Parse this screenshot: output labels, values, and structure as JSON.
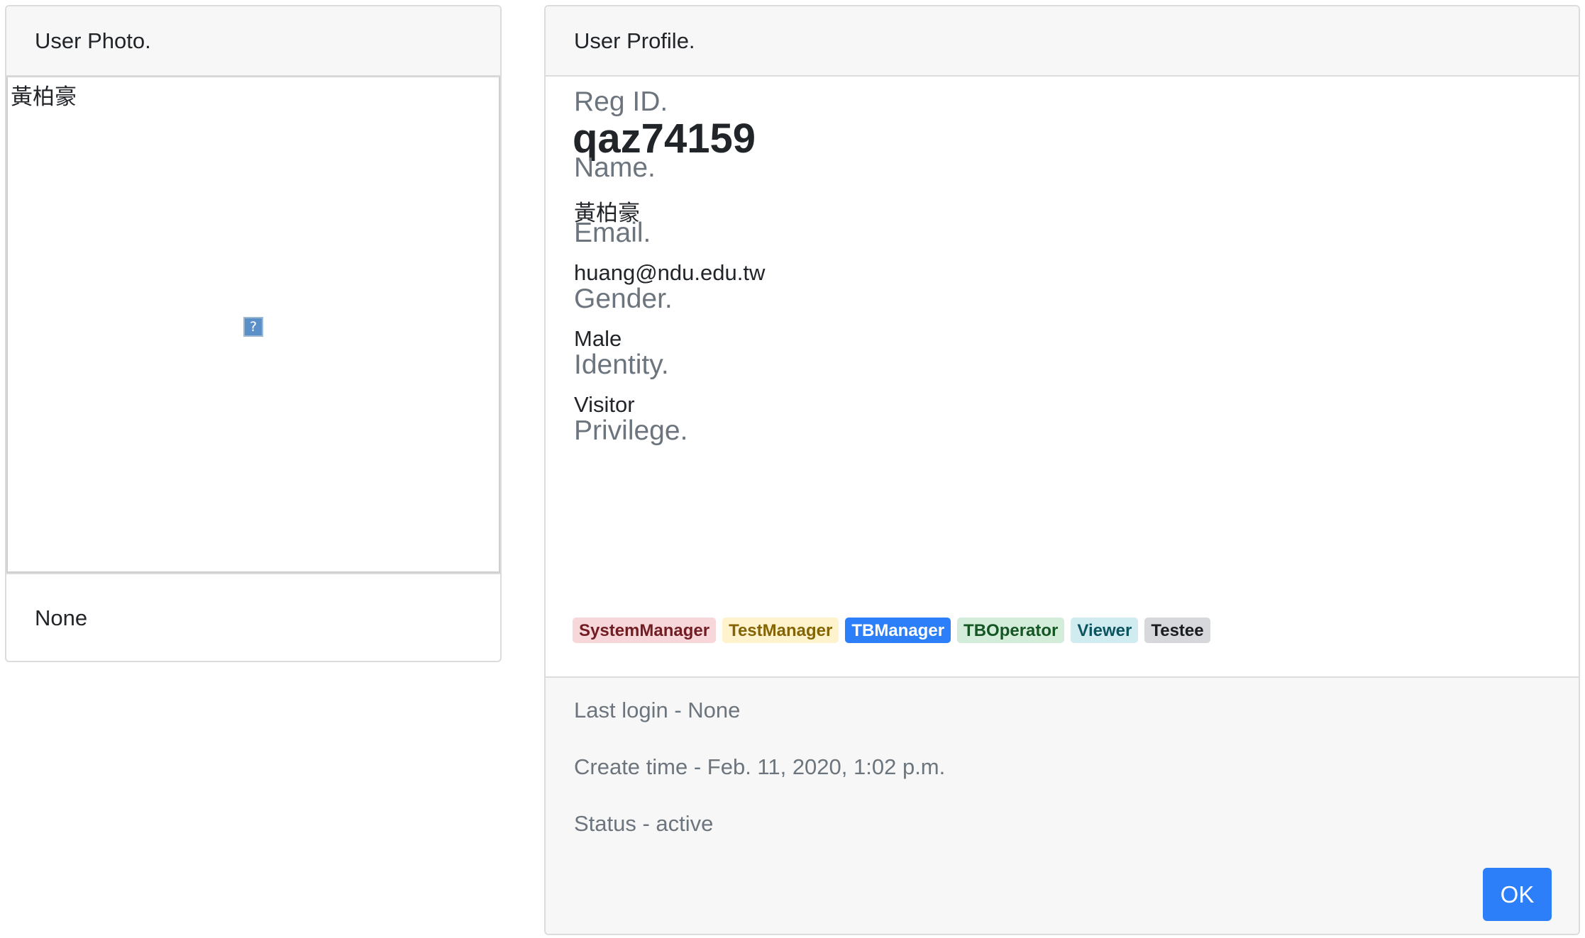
{
  "photo_card": {
    "header": "User Photo.",
    "photo_alt": "黃柏豪",
    "footer": "None"
  },
  "profile_card": {
    "header": "User Profile.",
    "reg_id_label": "Reg ID.",
    "reg_id_value": "qaz74159",
    "name_label": "Name.",
    "name_value": "黃柏豪",
    "email_label": "Email.",
    "email_value": "huang@ndu.edu.tw",
    "gender_label": "Gender.",
    "gender_value": "Male",
    "identity_label": "Identity.",
    "identity_value": "Visitor",
    "privilege_label": "Privilege.",
    "privileges": [
      "SystemManager",
      "TestManager",
      "TBManager",
      "TBOperator",
      "Viewer",
      "Testee"
    ],
    "last_login": "Last login - None",
    "create_time": "Create time - Feb. 11, 2020, 1:02 p.m.",
    "status": "Status - active",
    "ok_label": "OK"
  },
  "colors": {
    "primary": "#2d7ff9",
    "muted_text": "#6c757d",
    "header_bg": "#f7f7f7"
  }
}
